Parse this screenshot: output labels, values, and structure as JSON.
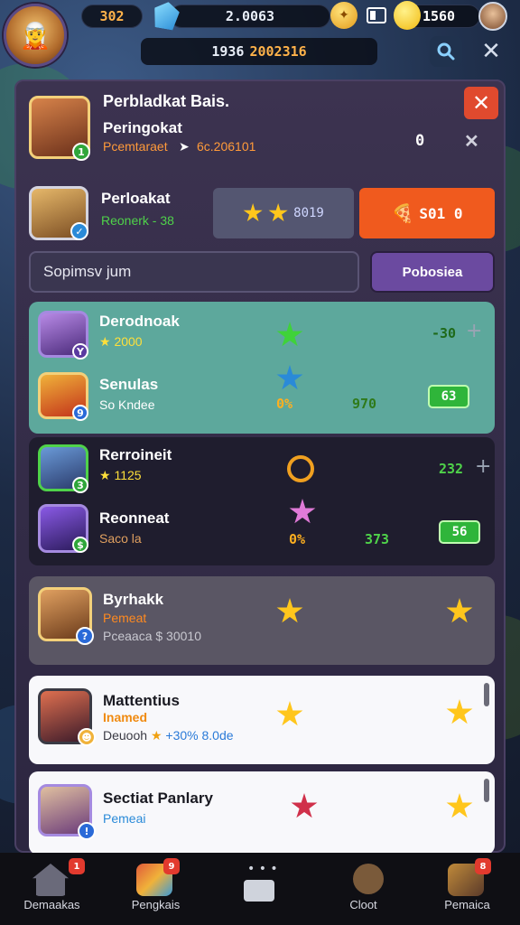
{
  "topbar": {
    "level": "302",
    "gems": "2.0063",
    "coins": "1560",
    "banner_left": "1936",
    "banner_right": "2002316"
  },
  "header": {
    "title": "Perbladkat Bais.",
    "name": "Peringokat",
    "sub_left": "Pcemtaraet",
    "sub_right": "6c.206101",
    "count": "0"
  },
  "player": {
    "name": "Perloakat",
    "sub": "Reonerk - 38",
    "gray_value": "8019",
    "orange_value": "S01 0"
  },
  "search": {
    "placeholder": "Sopimsv jum",
    "button": "Pobosiea"
  },
  "groups": [
    {
      "items": [
        {
          "title": "Derodnoak",
          "sub": "2000",
          "center_num": "",
          "right_num": "-30"
        },
        {
          "title": "Senulas",
          "sub": "So Kndee",
          "center_num": "0%",
          "center_num2": "970",
          "right_btn": "63"
        }
      ]
    },
    {
      "items": [
        {
          "title": "Rerroineit",
          "sub": "1125",
          "right_num": "232"
        },
        {
          "title": "Reonneat",
          "sub": "Saco la",
          "center_num": "0%",
          "center_num2": "373",
          "right_btn": "56"
        }
      ]
    }
  ],
  "cards": [
    {
      "title": "Byrhakk",
      "sub1": "Pemeat",
      "sub2": "Pceaaca $ 30010"
    },
    {
      "title": "Mattentius",
      "sub1": "Inamed",
      "sub2": "Deuooh",
      "sub3": "+30% 8.0de"
    },
    {
      "title": "Sectiat Panlary",
      "sub1": "Pemeai"
    }
  ],
  "nav": [
    {
      "label": "Demaakas",
      "badge": "1"
    },
    {
      "label": "Pengkais",
      "badge": "9"
    },
    {
      "label": ""
    },
    {
      "label": "Cloot"
    },
    {
      "label": "Pemaica",
      "badge": "8"
    }
  ]
}
